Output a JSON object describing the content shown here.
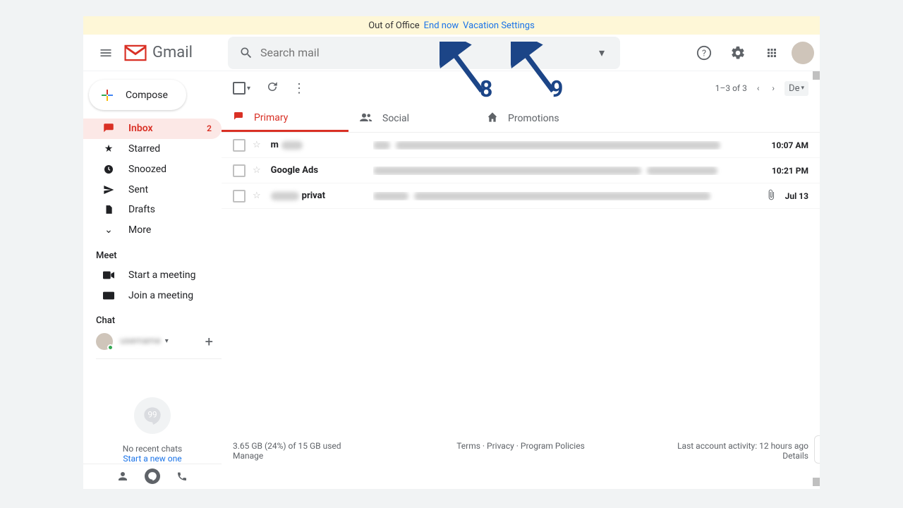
{
  "banner": {
    "status": "Out of Office",
    "end": "End now",
    "settings": "Vacation Settings"
  },
  "logo": "Gmail",
  "search": {
    "placeholder": "Search mail"
  },
  "compose": "Compose",
  "nav": {
    "inbox": "Inbox",
    "inbox_count": "2",
    "starred": "Starred",
    "snoozed": "Snoozed",
    "sent": "Sent",
    "drafts": "Drafts",
    "more": "More"
  },
  "meet": {
    "title": "Meet",
    "start": "Start a meeting",
    "join": "Join a meeting"
  },
  "chat": {
    "title": "Chat",
    "name": "username",
    "no_recent": "No recent chats",
    "start_new": "Start a new one"
  },
  "toolbar": {
    "count": "1–3 of 3",
    "lang": "De"
  },
  "tabs": {
    "primary": "Primary",
    "social": "Social",
    "promotions": "Promotions"
  },
  "messages": [
    {
      "sender_a": "m",
      "sender_b": "",
      "subj": "",
      "body": "",
      "date": "10:07 AM",
      "attach": false
    },
    {
      "sender_a": "Google Ads",
      "sender_b": "",
      "subj": "",
      "body": "",
      "date": "10:21 PM",
      "attach": false
    },
    {
      "sender_a": "",
      "sender_b": "privat",
      "subj": "",
      "body": "",
      "date": "Jul 13",
      "attach": true
    }
  ],
  "footer": {
    "storage": "3.65 GB (24%) of 15 GB used",
    "manage": "Manage",
    "terms": "Terms",
    "privacy": "Privacy",
    "policies": "Program Policies",
    "activity": "Last account activity: 12 hours ago",
    "details": "Details"
  },
  "annotations": {
    "a8": "8",
    "a9": "9"
  }
}
